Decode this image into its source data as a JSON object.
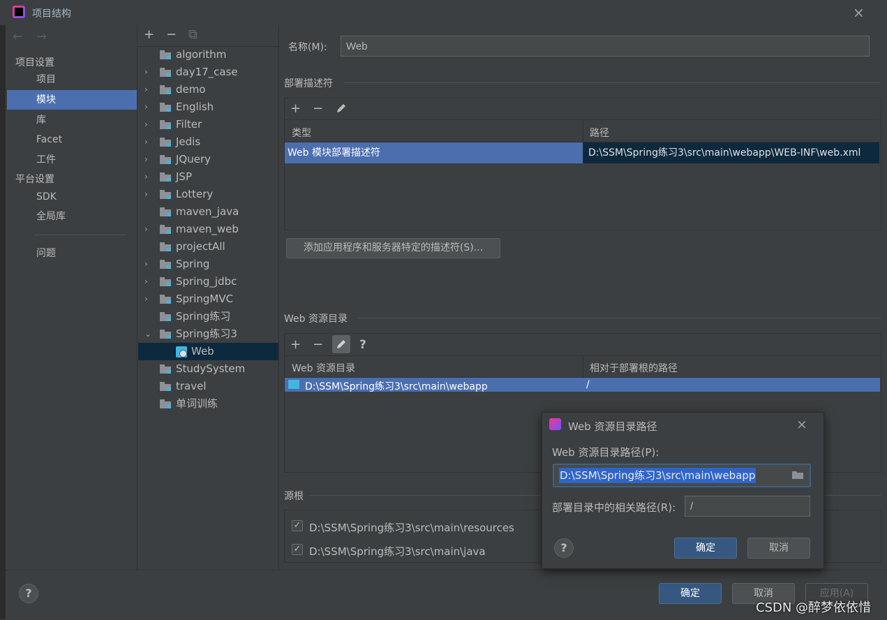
{
  "window": {
    "title": "项目结构",
    "close_icon": "×"
  },
  "nav": {
    "back": "←",
    "forward": "→",
    "section_project": "项目设置",
    "items_project": [
      "项目",
      "模块",
      "库",
      "Facet",
      "工件"
    ],
    "section_platform": "平台设置",
    "items_platform": [
      "SDK",
      "全局库"
    ],
    "problems": "问题",
    "selected": "模块"
  },
  "tree": {
    "add": "+",
    "remove": "−",
    "copy": "⧉",
    "items": [
      {
        "label": "algorithm",
        "chevron": ""
      },
      {
        "label": "day17_case",
        "chevron": "›"
      },
      {
        "label": "demo",
        "chevron": "›"
      },
      {
        "label": "English",
        "chevron": "›"
      },
      {
        "label": "Filter",
        "chevron": "›"
      },
      {
        "label": "Jedis",
        "chevron": "›"
      },
      {
        "label": "JQuery",
        "chevron": "›"
      },
      {
        "label": "JSP",
        "chevron": "›"
      },
      {
        "label": "Lottery",
        "chevron": "›"
      },
      {
        "label": "maven_java",
        "chevron": ""
      },
      {
        "label": "maven_web",
        "chevron": "›"
      },
      {
        "label": "projectAll",
        "chevron": ""
      },
      {
        "label": "Spring",
        "chevron": "›"
      },
      {
        "label": "Spring_jdbc",
        "chevron": "›"
      },
      {
        "label": "SpringMVC",
        "chevron": "›"
      },
      {
        "label": "Spring练习",
        "chevron": ""
      },
      {
        "label": "Spring练习3",
        "chevron": "⌄"
      },
      {
        "label": "Web",
        "chevron": ""
      },
      {
        "label": "StudySystem",
        "chevron": ""
      },
      {
        "label": "travel",
        "chevron": ""
      },
      {
        "label": "单词训练",
        "chevron": ""
      }
    ]
  },
  "main": {
    "name_label": "名称(M):",
    "name_value": "Web",
    "deploy_title": "部署描述符",
    "deploy_cols": [
      "类型",
      "路径"
    ],
    "deploy_row": [
      "Web 模块部署描述符",
      "D:\\SSM\\Spring练习3\\src\\main\\webapp\\WEB-INF\\web.xml"
    ],
    "add_descriptor_btn": "添加应用程序和服务器特定的描述符(S)...",
    "web_res_title": "Web 资源目录",
    "web_res_cols": [
      "Web 资源目录",
      "相对于部署根的路径"
    ],
    "web_res_row": [
      "D:\\SSM\\Spring练习3\\src\\main\\webapp",
      "/"
    ],
    "help_q": "?",
    "source_title": "源根",
    "sources": [
      "D:\\SSM\\Spring练习3\\src\\main\\resources",
      "D:\\SSM\\Spring练习3\\src\\main\\java"
    ]
  },
  "dialog": {
    "title": "Web 资源目录路径",
    "close": "×",
    "path_label": "Web 资源目录路径(P):",
    "path_value": "D:\\SSM\\Spring练习3\\src\\main\\webapp",
    "rel_label": "部署目录中的相关路径(R):",
    "rel_value": "/",
    "ok": "确定",
    "cancel": "取消",
    "help": "?"
  },
  "footer": {
    "help": "?",
    "ok": "确定",
    "cancel": "取消",
    "apply": "应用(A)"
  },
  "watermark": "CSDN @醉梦依依惜",
  "colors": {
    "accent": "#4b6eaf",
    "primary_button": "#365880",
    "background": "#3c3f41"
  }
}
